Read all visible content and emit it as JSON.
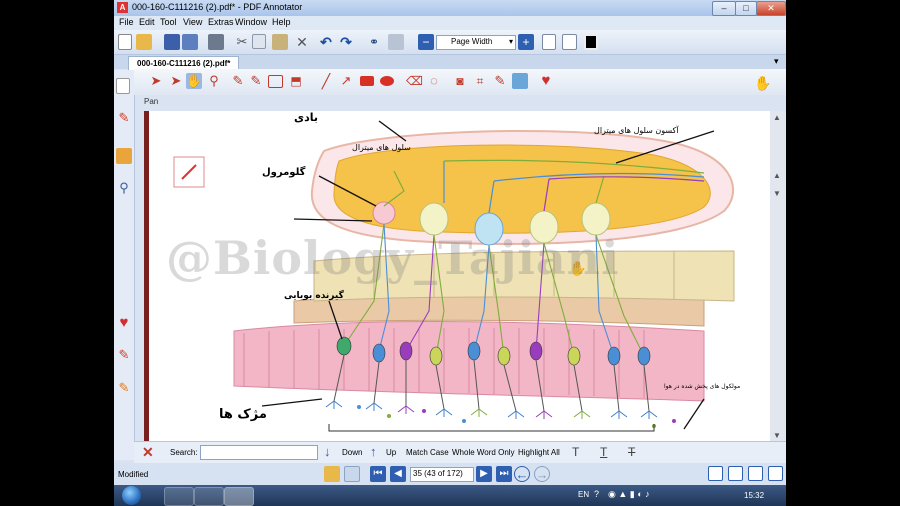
{
  "window": {
    "title": "000-160-C111216 (2).pdf* - PDF Annotator",
    "app_icon": "A",
    "minimize": "–",
    "maximize": "□",
    "close": "✕"
  },
  "menu": [
    "File",
    "Edit",
    "Tool",
    "View",
    "Extras",
    "Window",
    "Help"
  ],
  "toolbar": {
    "zoom_value": "Page Width"
  },
  "tab": {
    "label": "000-160-C111216 (2).pdf*",
    "close": "✕"
  },
  "annotation_toolbar": {
    "pan_label": "Pan"
  },
  "document": {
    "watermark": "@Biology_Tajiani",
    "labels": {
      "top_partial": "بادی",
      "mitral_cells": "سلول های میترال",
      "mitral_axon": "آکسون سلول های میترال",
      "glomerulus": "گلومرول",
      "receptor": "گیرنده بویایی",
      "cilia": "مژک ها",
      "odor_molecules": "مولکول های پخش شده در هوا"
    }
  },
  "search": {
    "label": "Search:",
    "value": "",
    "down": "Down",
    "up": "Up",
    "match_case": "Match Case",
    "whole_word": "Whole Word Only",
    "highlight_all": "Highlight All"
  },
  "status": {
    "text": "Modified",
    "page_field": "35 (43 of 172)"
  },
  "taskbar": {
    "language": "EN",
    "time": "15:32"
  },
  "colors": {
    "bulb_fill": "#f5c24a",
    "bulb_border": "#e8b6a5",
    "bone": "#efe2b4",
    "epithelium": "#f0a9bd",
    "mitral_green": "#7fae3a",
    "cell_purple": "#9a3dbd",
    "cell_blue": "#4a8fd6"
  }
}
